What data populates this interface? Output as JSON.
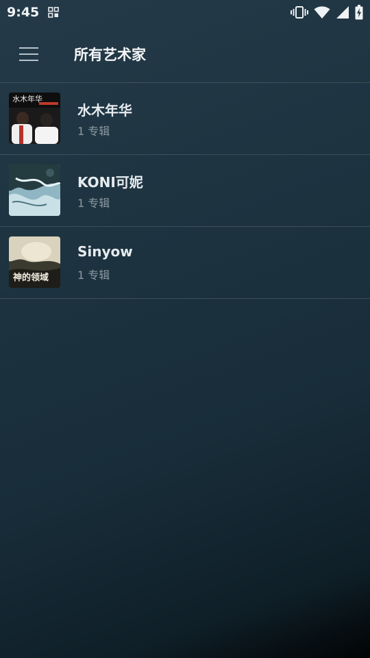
{
  "status_bar": {
    "time": "9:45"
  },
  "app_bar": {
    "title": "所有艺术家"
  },
  "artists": [
    {
      "name": "水木年华",
      "albums": "1 专辑",
      "cover_text": "水木年华"
    },
    {
      "name": "KONI可妮",
      "albums": "1 专辑"
    },
    {
      "name": "Sinyow",
      "albums": "1 专辑",
      "cover_text": "神的领域"
    }
  ],
  "icons": {
    "menu": "hamburger-menu-icon",
    "app_notification": "grid-app-icon",
    "vibrate": "vibrate-icon",
    "wifi": "wifi-icon",
    "signal": "cell-signal-icon",
    "battery": "battery-charging-icon"
  }
}
